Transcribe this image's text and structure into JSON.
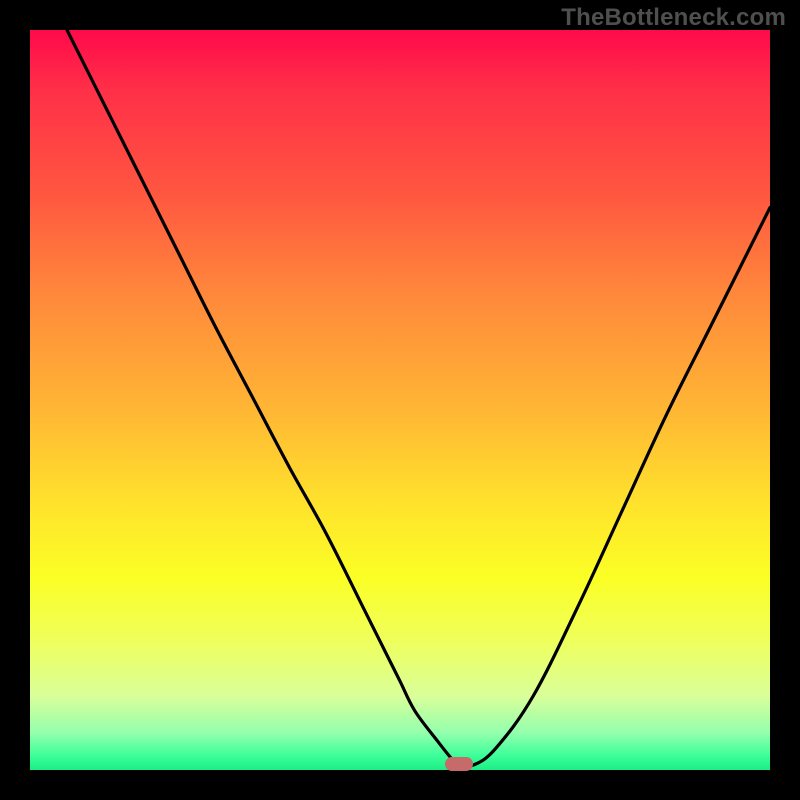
{
  "watermark": "TheBottleneck.com",
  "colors": {
    "frame": "#000000",
    "curve": "#000000",
    "marker": "#c76a6a",
    "gradient_top": "#ff0a4a",
    "gradient_bottom": "#1cee85"
  },
  "chart_data": {
    "type": "line",
    "title": "",
    "xlabel": "",
    "ylabel": "",
    "xlim": [
      0,
      100
    ],
    "ylim": [
      0,
      100
    ],
    "grid": false,
    "legend": false,
    "series": [
      {
        "name": "curve",
        "x": [
          5,
          10,
          15,
          20,
          25,
          30,
          35,
          40,
          45,
          48,
          50,
          52,
          55,
          57,
          58,
          60,
          63,
          68,
          74,
          80,
          86,
          92,
          100
        ],
        "y": [
          100,
          90,
          80,
          70,
          60,
          50.5,
          41,
          32,
          22,
          16,
          12,
          8,
          4,
          1.5,
          0.7,
          0.7,
          3,
          10,
          22,
          35,
          48,
          60,
          76
        ]
      }
    ],
    "marker": {
      "x": 58,
      "y": 0.8
    }
  },
  "layout": {
    "image_size": 800,
    "border": 30,
    "plot_size": 740
  }
}
